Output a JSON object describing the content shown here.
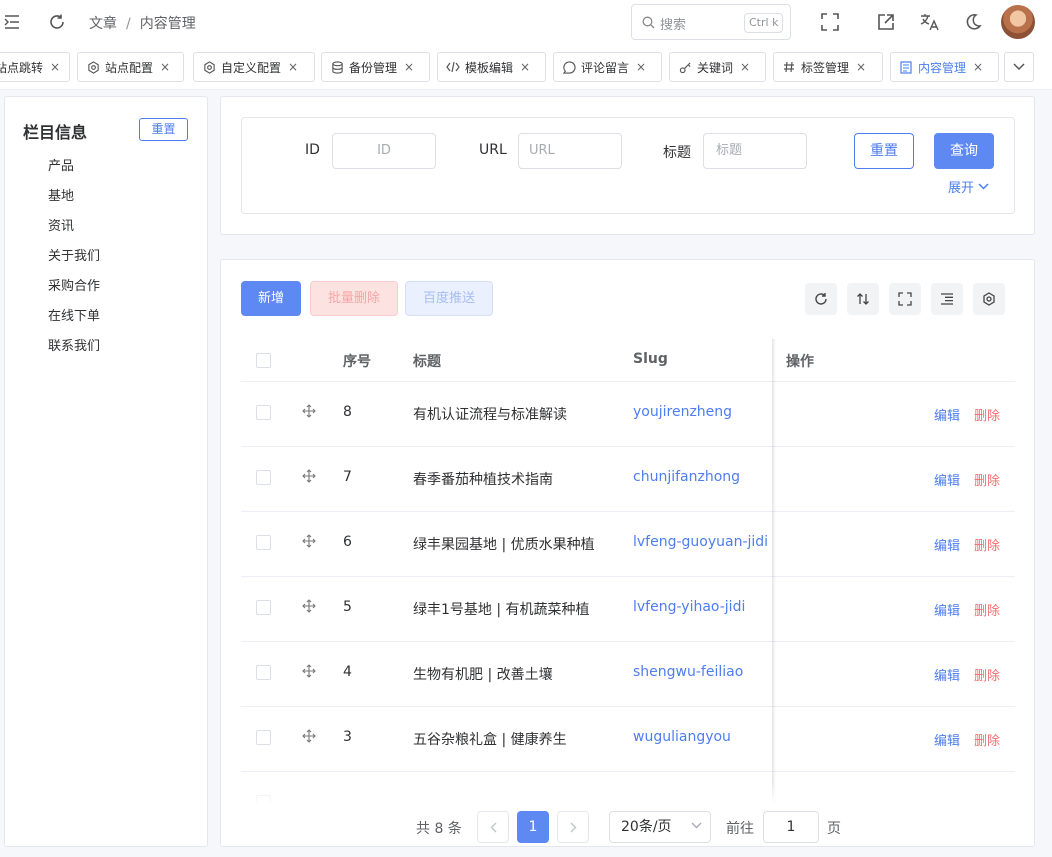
{
  "header": {
    "breadcrumb": [
      "文章",
      "内容管理"
    ],
    "breadcrumb_sep": "/",
    "search_placeholder": "搜索",
    "search_shortcut": "Ctrl k"
  },
  "tabs": [
    {
      "label": "站点跳转",
      "icon": "none"
    },
    {
      "label": "站点配置",
      "icon": "gear-icon"
    },
    {
      "label": "自定义配置",
      "icon": "gear-icon"
    },
    {
      "label": "备份管理",
      "icon": "database-icon"
    },
    {
      "label": "模板编辑",
      "icon": "code-icon"
    },
    {
      "label": "评论留言",
      "icon": "comment-icon"
    },
    {
      "label": "关键词",
      "icon": "key-icon"
    },
    {
      "label": "标签管理",
      "icon": "hash-icon"
    },
    {
      "label": "内容管理",
      "icon": "document-icon",
      "active": true
    }
  ],
  "tab_close": "×",
  "sidebar": {
    "title": "栏目信息",
    "reset_label": "重置",
    "items": [
      "产品",
      "基地",
      "资讯",
      "关于我们",
      "采购合作",
      "在线下单",
      "联系我们"
    ]
  },
  "filter": {
    "id_label": "ID",
    "id_placeholder": "ID",
    "url_label": "URL",
    "url_placeholder": "URL",
    "title_label": "标题",
    "title_placeholder": "标题",
    "reset_label": "重置",
    "query_label": "查询",
    "expand_label": "展开"
  },
  "toolbar": {
    "add_label": "新增",
    "batch_delete_label": "批量删除",
    "baidu_push_label": "百度推送"
  },
  "table": {
    "columns": {
      "index": "序号",
      "title": "标题",
      "slug": "Slug",
      "actions": "操作"
    },
    "edit_label": "编辑",
    "delete_label": "删除",
    "rows": [
      {
        "index": "8",
        "title": "有机认证流程与标准解读",
        "slug": "youjirenzheng"
      },
      {
        "index": "7",
        "title": "春季番茄种植技术指南",
        "slug": "chunjifanzhong"
      },
      {
        "index": "6",
        "title": "绿丰果园基地 | 优质水果种植",
        "slug": "lvfeng-guoyuan-jidi"
      },
      {
        "index": "5",
        "title": "绿丰1号基地 | 有机蔬菜种植",
        "slug": "lvfeng-yihao-jidi"
      },
      {
        "index": "4",
        "title": "生物有机肥 | 改善土壤",
        "slug": "shengwu-feiliao"
      },
      {
        "index": "3",
        "title": "五谷杂粮礼盒 | 健康养生",
        "slug": "wuguliangyou"
      }
    ]
  },
  "pagination": {
    "total_label": "共 8 条",
    "current_page": "1",
    "page_size_label": "20条/页",
    "goto_label": "前往",
    "goto_value": "1",
    "page_suffix": "页"
  },
  "colors": {
    "primary": "#5e89f2",
    "danger": "#f56c6c",
    "link": "#4e7df0"
  }
}
